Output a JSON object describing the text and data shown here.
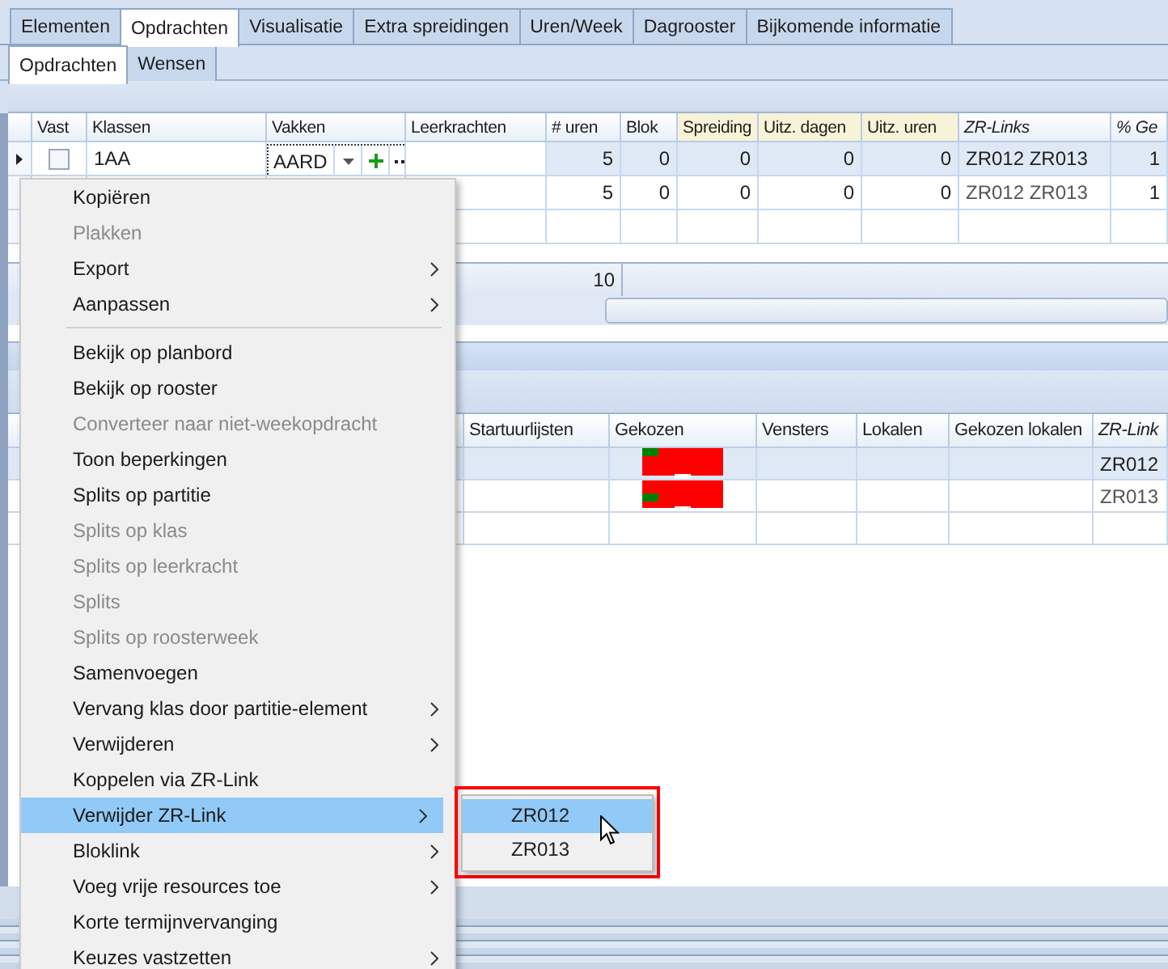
{
  "tabs": [
    {
      "label": "Elementen",
      "selected": false
    },
    {
      "label": "Opdrachten",
      "selected": true
    },
    {
      "label": "Visualisatie",
      "selected": false
    },
    {
      "label": "Extra spreidingen",
      "selected": false
    },
    {
      "label": "Uren/Week",
      "selected": false
    },
    {
      "label": "Dagrooster",
      "selected": false
    },
    {
      "label": "Bijkomende informatie",
      "selected": false
    }
  ],
  "subtabs": [
    {
      "label": "Opdrachten",
      "selected": true
    },
    {
      "label": "Wensen",
      "selected": false
    }
  ],
  "grid": {
    "columns": [
      {
        "label": "Vast"
      },
      {
        "label": "Klassen"
      },
      {
        "label": "Vakken"
      },
      {
        "label": "Leerkrachten"
      },
      {
        "label": "# uren"
      },
      {
        "label": "Blok"
      },
      {
        "label": "Spreiding"
      },
      {
        "label": "Uitz. dagen"
      },
      {
        "label": "Uitz. uren"
      },
      {
        "label": "ZR-Links"
      },
      {
        "label": "% Ge"
      }
    ],
    "rows": [
      {
        "selected": true,
        "vast_checked": false,
        "cells": [
          null,
          "1AA",
          "AARD",
          null,
          "5",
          "0",
          "0",
          "0",
          "0",
          "ZR012 ZR013",
          "1"
        ]
      },
      {
        "selected": false,
        "cells": [
          null,
          null,
          null,
          null,
          "5",
          "0",
          "0",
          "0",
          "0",
          "ZR012 ZR013",
          "1"
        ]
      },
      {
        "selected": false,
        "cells": [
          null,
          null,
          null,
          null,
          null,
          null,
          null,
          null,
          null,
          null,
          null
        ]
      }
    ],
    "footer_total": "10"
  },
  "detail_grid": {
    "columns": [
      {
        "label": "Startuurlijsten"
      },
      {
        "label": "Gekozen"
      },
      {
        "label": "Vensters"
      },
      {
        "label": "Lokalen"
      },
      {
        "label": "Gekozen lokalen"
      },
      {
        "label": "ZR-Link"
      }
    ],
    "rows": [
      {
        "selected": true,
        "zr_link": "ZR012"
      },
      {
        "selected": false,
        "zr_link": "ZR013"
      },
      {
        "selected": false
      }
    ]
  },
  "context_menu": {
    "items": [
      {
        "kind": "item",
        "label": "Kopiëren",
        "disabled": false,
        "submenu": false,
        "selected": false
      },
      {
        "kind": "item",
        "label": "Plakken",
        "disabled": true,
        "submenu": false,
        "selected": false
      },
      {
        "kind": "item",
        "label": "Export",
        "disabled": false,
        "submenu": true,
        "selected": false
      },
      {
        "kind": "item",
        "label": "Aanpassen",
        "disabled": false,
        "submenu": true,
        "selected": false
      },
      {
        "kind": "separator"
      },
      {
        "kind": "item",
        "label": "Bekijk op planbord",
        "disabled": false,
        "submenu": false,
        "selected": false
      },
      {
        "kind": "item",
        "label": "Bekijk op rooster",
        "disabled": false,
        "submenu": false,
        "selected": false
      },
      {
        "kind": "item",
        "label": "Converteer naar niet-weekopdracht",
        "disabled": true,
        "submenu": false,
        "selected": false
      },
      {
        "kind": "item",
        "label": "Toon beperkingen",
        "disabled": false,
        "submenu": false,
        "selected": false
      },
      {
        "kind": "item",
        "label": "Splits op partitie",
        "disabled": false,
        "submenu": false,
        "selected": false
      },
      {
        "kind": "item",
        "label": "Splits op klas",
        "disabled": true,
        "submenu": false,
        "selected": false
      },
      {
        "kind": "item",
        "label": "Splits op leerkracht",
        "disabled": true,
        "submenu": false,
        "selected": false
      },
      {
        "kind": "item",
        "label": "Splits",
        "disabled": true,
        "submenu": false,
        "selected": false
      },
      {
        "kind": "item",
        "label": "Splits op roosterweek",
        "disabled": true,
        "submenu": false,
        "selected": false
      },
      {
        "kind": "item",
        "label": "Samenvoegen",
        "disabled": false,
        "submenu": false,
        "selected": false
      },
      {
        "kind": "item",
        "label": "Vervang klas door partitie-element",
        "disabled": false,
        "submenu": true,
        "selected": false
      },
      {
        "kind": "item",
        "label": "Verwijderen",
        "disabled": false,
        "submenu": true,
        "selected": false
      },
      {
        "kind": "item",
        "label": "Koppelen via ZR-Link",
        "disabled": false,
        "submenu": false,
        "selected": false
      },
      {
        "kind": "item",
        "label": "Verwijder ZR-Link",
        "disabled": false,
        "submenu": true,
        "selected": true
      },
      {
        "kind": "item",
        "label": "Bloklink",
        "disabled": false,
        "submenu": true,
        "selected": false
      },
      {
        "kind": "item",
        "label": "Voeg vrije resources toe",
        "disabled": false,
        "submenu": true,
        "selected": false
      },
      {
        "kind": "item",
        "label": "Korte termijnvervanging",
        "disabled": false,
        "submenu": false,
        "selected": false
      },
      {
        "kind": "item",
        "label": "Keuzes vastzetten",
        "disabled": false,
        "submenu": true,
        "selected": false
      }
    ]
  },
  "submenu": {
    "items": [
      {
        "label": "ZR012",
        "selected": true
      },
      {
        "label": "ZR013",
        "selected": false
      }
    ]
  }
}
